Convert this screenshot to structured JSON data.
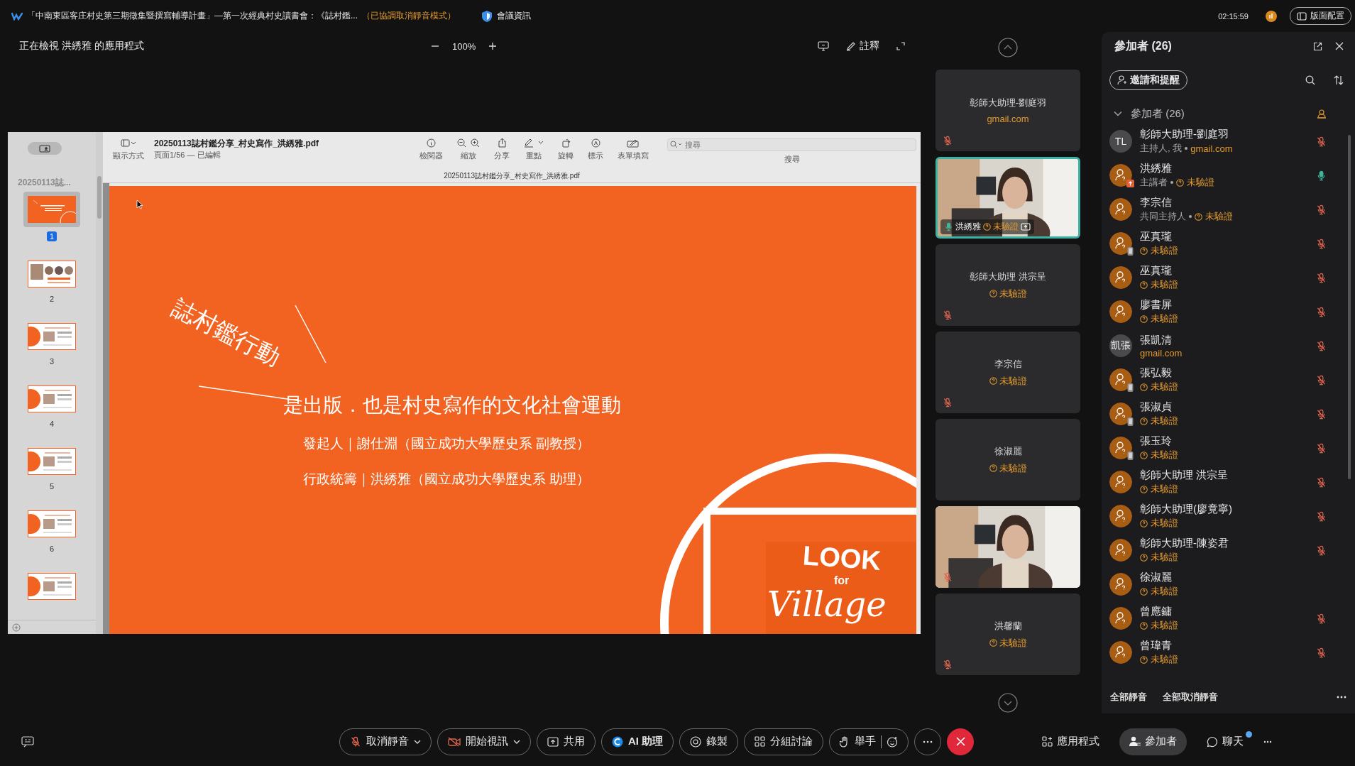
{
  "title_bar": {
    "meeting_title": "「中南東區客庄村史第三期徵集暨撰寫輔導計畫」—第一次經典村史讀書會：《誌村鑑...",
    "notice": "（已協調取消靜音模式）",
    "info_button": "會議資訊",
    "time": "02:15:59",
    "layout_button": "版面配置"
  },
  "share_bar": {
    "viewing": "正在檢視 洪綉雅 的應用程式",
    "zoom": "100%",
    "annotate": "註釋"
  },
  "pdf_viewer": {
    "view_label": "顯示方式",
    "filename": "20250113誌村鑑分享_村史寫作_洪綉雅.pdf",
    "page_info": "頁面1/56 — 已編輯",
    "tools": [
      {
        "kind": "inspector",
        "label": "檢閱器"
      },
      {
        "kind": "zoom",
        "label": "縮放"
      },
      {
        "kind": "share",
        "label": "分享"
      },
      {
        "kind": "highlight",
        "label": "重點"
      },
      {
        "kind": "rotate",
        "label": "旋轉"
      },
      {
        "kind": "markup",
        "label": "標示"
      },
      {
        "kind": "form",
        "label": "表單填寫"
      }
    ],
    "search_placeholder": "搜尋",
    "search_label": "搜尋",
    "doc_title": "20250113誌村鑑分享_村史寫作_洪綉雅.pdf",
    "sidebar_title": "20250113誌...",
    "thumbnails": [
      {
        "label": "1",
        "selected": true,
        "kind": "cover"
      },
      {
        "label": "2",
        "selected": false,
        "kind": "photos"
      },
      {
        "label": "3",
        "selected": false,
        "kind": "section"
      },
      {
        "label": "4",
        "selected": false,
        "kind": "section"
      },
      {
        "label": "5",
        "selected": false,
        "kind": "section"
      },
      {
        "label": "6",
        "selected": false,
        "kind": "section"
      },
      {
        "selected": false,
        "kind": "section"
      }
    ],
    "slide": {
      "tag": "誌村鑑行動",
      "headline": "是出版．也是村史寫作的文化社會運動",
      "lines": [
        "發起人｜謝仕淵（國立成功大學歷史系 副教授）",
        "行政統籌｜洪綉雅（國立成功大學歷史系 助理）"
      ],
      "logo_top": "LOOK",
      "logo_mid": "for",
      "logo_bottom": "Village"
    }
  },
  "video_tiles": [
    {
      "kind": "card",
      "name": "彰師大助理-劉庭羽",
      "email": "gmail.com",
      "muted": true
    },
    {
      "kind": "video",
      "name": "洪綉雅",
      "status": "未驗證",
      "muted": false,
      "active": true,
      "sharing": true
    },
    {
      "kind": "card",
      "name": "彰師大助理 洪宗呈",
      "status": "未驗證",
      "muted": true
    },
    {
      "kind": "card",
      "name": "李宗信",
      "status": "未驗證",
      "muted": true
    },
    {
      "kind": "card",
      "name": "徐淑麗",
      "status": "未驗證",
      "muted": false
    },
    {
      "kind": "video",
      "muted": true,
      "active": false
    },
    {
      "kind": "card",
      "name": "洪馨蘭",
      "status": "未驗證",
      "muted": true
    }
  ],
  "participants": {
    "title": "參加者 (26)",
    "invite": "邀請和提醒",
    "group": "參加者 (26)",
    "expanded": true,
    "rows": [
      {
        "initials": "TL",
        "name": "彰師大助理-劉庭羽",
        "role": "主持人, 我",
        "email": "gmail.com",
        "muted": true
      },
      {
        "name": "洪綉雅",
        "role": "主講者",
        "status": "未驗證",
        "presenting": true,
        "muted": false
      },
      {
        "name": "李宗信",
        "role": "共同主持人",
        "status": "未驗證",
        "muted": true
      },
      {
        "name": "巫真瓏",
        "status": "未驗證",
        "phone": true,
        "muted": true
      },
      {
        "name": "巫真瓏",
        "status": "未驗證",
        "muted": true
      },
      {
        "name": "廖書屏",
        "status": "未驗證",
        "muted": true
      },
      {
        "initials": "凱張",
        "name": "張凱清",
        "email": "gmail.com",
        "muted": true
      },
      {
        "name": "張弘毅",
        "status": "未驗證",
        "phone": true,
        "muted": true
      },
      {
        "name": "張淑貞",
        "status": "未驗證",
        "phone": true,
        "muted": true
      },
      {
        "name": "張玉玲",
        "status": "未驗證",
        "phone": true,
        "muted": true
      },
      {
        "name": "彰師大助理 洪宗呈",
        "status": "未驗證",
        "muted": true
      },
      {
        "name": "彰師大助理(廖竟寧)",
        "status": "未驗證",
        "muted": true
      },
      {
        "name": "彰師大助理-陳姿君",
        "status": "未驗證",
        "muted": true
      },
      {
        "name": "徐淑麗",
        "status": "未驗證"
      },
      {
        "name": "曾應鏞",
        "status": "未驗證",
        "muted": true
      },
      {
        "name": "曾瑋青",
        "status": "未驗證",
        "muted": true
      }
    ],
    "mute_all": "全部靜音",
    "unmute_all": "全部取消靜音"
  },
  "toolbar": {
    "buttons": [
      {
        "kind": "mute",
        "label": "取消靜音",
        "dropdown": true
      },
      {
        "kind": "video",
        "label": "開始視訊",
        "dropdown": true
      },
      {
        "kind": "share",
        "label": "共用"
      },
      {
        "kind": "ai",
        "label": "AI 助理"
      },
      {
        "kind": "record",
        "label": "錄製"
      },
      {
        "kind": "breakout",
        "label": "分組討論"
      },
      {
        "kind": "hand",
        "label": "舉手"
      }
    ],
    "side": [
      {
        "kind": "apps",
        "label": "應用程式",
        "selected": false
      },
      {
        "kind": "people",
        "label": "參加者",
        "selected": true
      },
      {
        "kind": "chat",
        "label": "聊天",
        "selected": false,
        "badge": true
      }
    ]
  }
}
